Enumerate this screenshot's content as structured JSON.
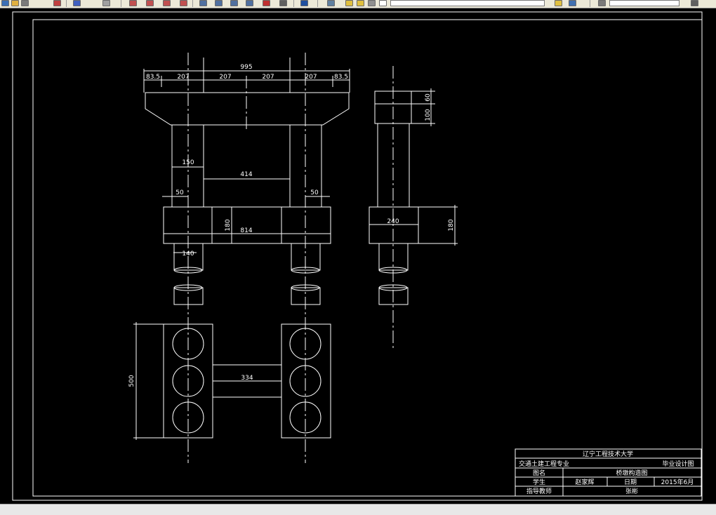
{
  "toolbar": {
    "icons": [
      {
        "name": "new-icon",
        "color": "#3b6fb6"
      },
      {
        "name": "open-icon",
        "color": "#e0b040"
      },
      {
        "name": "print-icon",
        "color": "#7a7a7a"
      },
      {
        "name": "cut-icon",
        "color": "#c04040"
      },
      {
        "name": "match-properties-icon",
        "color": "#4060c0"
      },
      {
        "name": "eraser-icon",
        "color": "#a0a0a0"
      },
      {
        "name": "zoom-realtime-icon",
        "color": "#c05050"
      },
      {
        "name": "zoom-window-icon",
        "color": "#c05050"
      },
      {
        "name": "zoom-previous-icon",
        "color": "#c05050"
      },
      {
        "name": "zoom-extents-icon",
        "color": "#c05050"
      },
      {
        "name": "properties-icon",
        "color": "#5070a0"
      },
      {
        "name": "design-center-icon",
        "color": "#5070a0"
      },
      {
        "name": "tool-palette-icon",
        "color": "#5070a0"
      },
      {
        "name": "sheet-set-icon",
        "color": "#5070a0"
      },
      {
        "name": "markup-icon",
        "color": "#c03030"
      },
      {
        "name": "calculator-icon",
        "color": "#606060"
      },
      {
        "name": "help-icon",
        "color": "#2050a0"
      },
      {
        "name": "layer-manager-icon",
        "color": "#6080a0"
      },
      {
        "name": "layer-light-icon",
        "color": "#e0c040"
      },
      {
        "name": "layer-sun-icon",
        "color": "#e0c040"
      },
      {
        "name": "layer-lock-icon",
        "color": "#909090"
      },
      {
        "name": "layer-color-icon",
        "color": "#ffffff"
      },
      {
        "name": "layer-state-icon",
        "color": "#e0c040"
      },
      {
        "name": "layer-previous-icon",
        "color": "#4070b0"
      },
      {
        "name": "match-layer-icon",
        "color": "#7a7a7a"
      },
      {
        "name": "plot-icon",
        "color": "#606060"
      }
    ]
  },
  "drawing": {
    "line_color": "#ffffff",
    "background": "#000000",
    "front_view": {
      "dims_top": [
        "83.5",
        "207",
        "207",
        "207",
        "207",
        "83.5"
      ],
      "overall_width": "995",
      "column_width": "150",
      "column_spacing": "414",
      "offset_left": "50",
      "offset_right": "50",
      "beam_height": "180",
      "beam_length": "814",
      "pile_dia": "140"
    },
    "side_view": {
      "cap_height_a": "100",
      "cap_height_b": "60",
      "beam_width": "240",
      "beam_height": "180"
    },
    "plan_view": {
      "overall_length": "500",
      "tie_spacing": "334"
    },
    "title_block": {
      "university": "辽宁工程技术大学",
      "major": "交通土建工程专业",
      "design_type": "毕业设计图",
      "drawing_name_label": "图名",
      "drawing_name": "桥墩构造图",
      "student_label": "学生",
      "student": "赵家辉",
      "date_label": "日期",
      "date": "2015年6月",
      "advisor_label": "指导教师",
      "advisor": "张彬"
    }
  }
}
